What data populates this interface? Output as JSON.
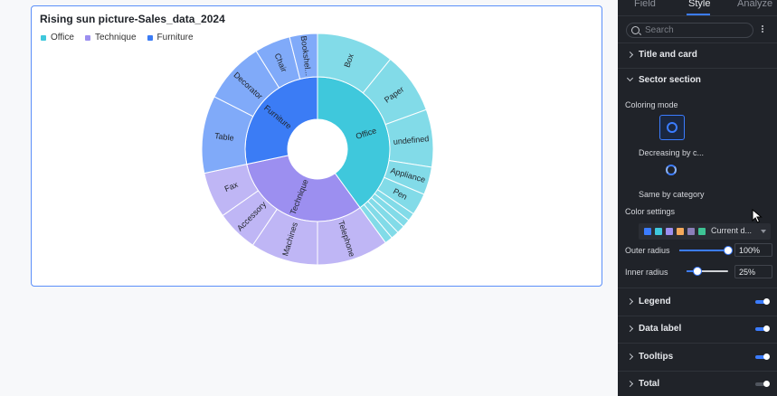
{
  "card": {
    "title": "Rising sun picture-Sales_data_2024"
  },
  "legend": [
    {
      "label": "Office",
      "color": "#3fc8dc"
    },
    {
      "label": "Technique",
      "color": "#9c8ff0"
    },
    {
      "label": "Furniture",
      "color": "#3b7cf5"
    }
  ],
  "chart_data": {
    "type": "sunburst",
    "title": "Rising sun picture-Sales_data_2024",
    "inner_radius_pct": 25,
    "outer_radius_pct": 100,
    "categories": [
      {
        "name": "Office",
        "color": "#3fc8dc",
        "start": 0,
        "end": 144,
        "children": [
          {
            "name": "Box",
            "start": 0,
            "end": 39
          },
          {
            "name": "Paper",
            "start": 39,
            "end": 70
          },
          {
            "name": "undefined",
            "start": 70,
            "end": 99
          },
          {
            "name": "Appliance",
            "start": 99,
            "end": 113
          },
          {
            "name": "Pen",
            "start": 113,
            "end": 124
          },
          {
            "name": "",
            "start": 124,
            "end": 128
          },
          {
            "name": "",
            "start": 128,
            "end": 132
          },
          {
            "name": "",
            "start": 132,
            "end": 136
          },
          {
            "name": "",
            "start": 136,
            "end": 140
          },
          {
            "name": "",
            "start": 140,
            "end": 144
          }
        ]
      },
      {
        "name": "Technique",
        "color": "#9c8ff0",
        "start": 144,
        "end": 258,
        "children": [
          {
            "name": "Telephone",
            "start": 144,
            "end": 180
          },
          {
            "name": "Machines",
            "start": 180,
            "end": 214
          },
          {
            "name": "Accessory",
            "start": 214,
            "end": 235
          },
          {
            "name": "Fax",
            "start": 235,
            "end": 258
          }
        ]
      },
      {
        "name": "Furniture",
        "color": "#3b7cf5",
        "start": 258,
        "end": 360,
        "children": [
          {
            "name": "Table",
            "start": 258,
            "end": 297
          },
          {
            "name": "Decorator",
            "start": 297,
            "end": 328
          },
          {
            "name": "Chair",
            "start": 328,
            "end": 346
          },
          {
            "name": "Bookshel...",
            "start": 346,
            "end": 360
          }
        ]
      }
    ]
  },
  "panel": {
    "tabs": [
      "Field",
      "Style",
      "Analyze"
    ],
    "active_tab": "Style",
    "search_placeholder": "Search",
    "sections": {
      "title_and_card": "Title and card",
      "sector_section": "Sector section",
      "legend": "Legend",
      "data_label": "Data label",
      "tooltips": "Tooltips",
      "total": "Total"
    },
    "coloring_mode_label": "Coloring mode",
    "mode_1": "Decreasing by c...",
    "mode_2": "Same by category",
    "color_settings_label": "Color settings",
    "color_settings_value": "Current d...",
    "swatches": [
      "#3b7cff",
      "#3fc8dc",
      "#9c8ff0",
      "#f5a95b",
      "#8a7fb8",
      "#3ec394"
    ],
    "outer_radius_label": "Outer radius",
    "outer_radius_value": "100%",
    "outer_radius_level": 1.0,
    "inner_radius_label": "Inner radius",
    "inner_radius_value": "25%",
    "inner_radius_level": 0.25
  }
}
